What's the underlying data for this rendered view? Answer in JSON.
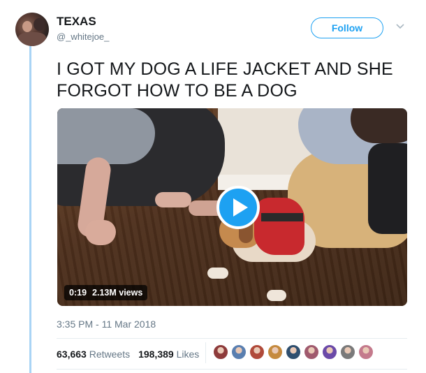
{
  "tweet": {
    "display_name": "TEXAS",
    "handle": "@_whitejoe_",
    "text": "I GOT MY DOG A LIFE JACKET AND SHE FORGOT HOW TO BE A DOG",
    "follow_label": "Follow",
    "timestamp": "3:35 PM - 11 Mar 2018"
  },
  "video": {
    "duration": "0:19",
    "views": "2.13M views"
  },
  "stats": {
    "retweets_count": "63,663",
    "retweets_label": "Retweets",
    "likes_count": "198,389",
    "likes_label": "Likes"
  },
  "likers": [
    {
      "icon": "liker-avatar",
      "color": "#8e3b3b"
    },
    {
      "icon": "liker-avatar",
      "color": "#5a7fb0"
    },
    {
      "icon": "liker-avatar",
      "color": "#b04a3a"
    },
    {
      "icon": "liker-avatar",
      "color": "#c58a3e"
    },
    {
      "icon": "liker-avatar",
      "color": "#2f4f6f"
    },
    {
      "icon": "liker-avatar",
      "color": "#a05a6e"
    },
    {
      "icon": "liker-avatar",
      "color": "#6b4aa8"
    },
    {
      "icon": "liker-avatar",
      "color": "#7a7a7a"
    },
    {
      "icon": "liker-avatar",
      "color": "#c47a8c"
    }
  ],
  "colors": {
    "accent": "#1da1f2",
    "secondary_text": "#657786",
    "thread_line": "#a9d4f5"
  }
}
